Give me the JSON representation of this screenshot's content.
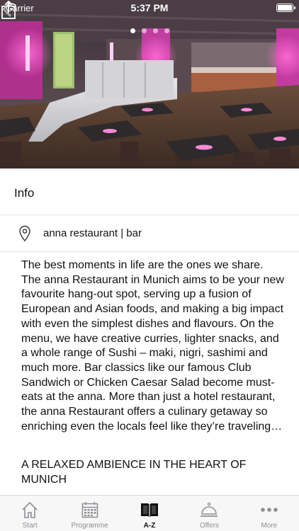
{
  "status_bar": {
    "carrier": "Carrier",
    "time": "5:37 PM"
  },
  "hero": {
    "image": "restaurant-interior-photo",
    "page_count": 4,
    "active_page": 1
  },
  "info": {
    "header": "Info",
    "location_icon": "map-pin-icon",
    "location_name": "anna restaurant | bar",
    "description": "The best moments in life are the ones we share. The anna Restaurant in Munich aims to be your new favourite hang-out spot, serving up a fusion of European and Asian foods, and making a big impact with even the simplest dishes and flavours. On the menu, we have creative curries, lighter snacks, and a whole  range of Sushi – maki, nigri, sashimi and much more. Bar classics like our famous Club Sandwich or Chicken Caesar Salad become must-eats at the anna. More than just a hotel restaurant, the anna Restaurant offers a culinary getaway so enriching even the locals feel like they’re traveling…",
    "subheading": "A RELAXED AMBIENCE IN THE HEART OF MUNICH"
  },
  "tabs": [
    {
      "label": "Start",
      "icon": "home-icon",
      "active": false
    },
    {
      "label": "Programme",
      "icon": "calendar-icon",
      "active": false
    },
    {
      "label": "A-Z",
      "icon": "book-icon",
      "active": true
    },
    {
      "label": "Offers",
      "icon": "service-bell-icon",
      "active": false
    },
    {
      "label": "More",
      "icon": "more-dots-icon",
      "active": false
    }
  ],
  "colors": {
    "accent_pink": "#d04bb0",
    "tab_inactive": "#8e8e93",
    "tab_active": "#111111"
  }
}
